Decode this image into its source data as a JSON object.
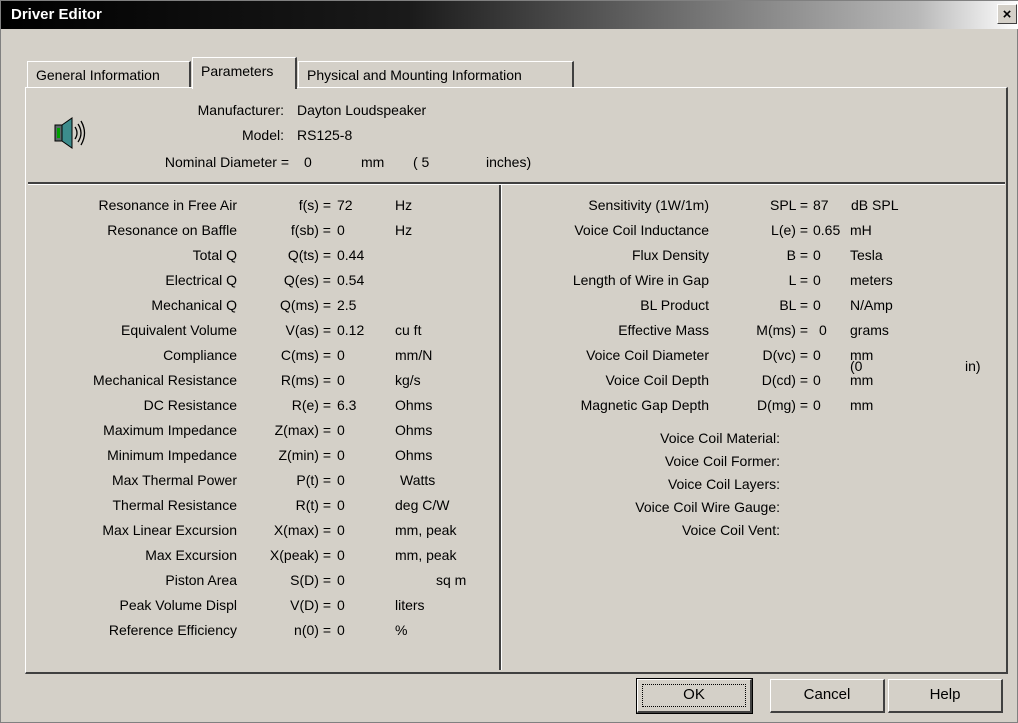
{
  "window": {
    "title": "Driver Editor",
    "close_label": "×"
  },
  "tabs": [
    {
      "label": "General Information"
    },
    {
      "label": "Parameters"
    },
    {
      "label": "Physical and Mounting Information"
    }
  ],
  "header": {
    "manufacturer_label": "Manufacturer:",
    "manufacturer_value": "Dayton Loudspeaker",
    "model_label": "Model:",
    "model_value": "RS125-8",
    "nominal_label": "Nominal Diameter =",
    "nominal_value": "0",
    "nominal_unit": "mm",
    "nominal_paren": "( 5",
    "nominal_inches": "inches)"
  },
  "left_params": [
    {
      "name": "Resonance in Free Air",
      "symbol": "f(s) =",
      "value": "72",
      "unit": "Hz"
    },
    {
      "name": "Resonance on Baffle",
      "symbol": "f(sb) =",
      "value": "0",
      "unit": "Hz"
    },
    {
      "name": "Total Q",
      "symbol": "Q(ts) =",
      "value": "0.44",
      "unit": ""
    },
    {
      "name": "Electrical Q",
      "symbol": "Q(es) =",
      "value": "0.54",
      "unit": ""
    },
    {
      "name": "Mechanical Q",
      "symbol": "Q(ms) =",
      "value": "2.5",
      "unit": ""
    },
    {
      "name": "Equivalent Volume",
      "symbol": "V(as) =",
      "value": "0.12",
      "unit": "cu ft"
    },
    {
      "name": "Compliance",
      "symbol": "C(ms) =",
      "value": "0",
      "unit": "mm/N"
    },
    {
      "name": "Mechanical Resistance",
      "symbol": "R(ms) =",
      "value": "0",
      "unit": "kg/s"
    },
    {
      "name": "DC Resistance",
      "symbol": "R(e) =",
      "value": "6.3",
      "unit": "Ohms"
    },
    {
      "name": "Maximum Impedance",
      "symbol": "Z(max) =",
      "value": "0",
      "unit": "Ohms"
    },
    {
      "name": "Minimum Impedance",
      "symbol": "Z(min) =",
      "value": "0",
      "unit": "Ohms"
    },
    {
      "name": "Max Thermal Power",
      "symbol": "P(t) =",
      "value": "0",
      "unit": "Watts"
    },
    {
      "name": "Thermal Resistance",
      "symbol": "R(t) =",
      "value": "0",
      "unit": "deg C/W"
    },
    {
      "name": "Max Linear Excursion",
      "symbol": "X(max) =",
      "value": "0",
      "unit": "mm, peak"
    },
    {
      "name": "Max Excursion",
      "symbol": "X(peak) =",
      "value": "0",
      "unit": "mm, peak"
    },
    {
      "name": "Piston Area",
      "symbol": "S(D) =",
      "value": "0",
      "unit": "sq m"
    },
    {
      "name": "Peak Volume Displ",
      "symbol": "V(D) =",
      "value": "0",
      "unit": "liters"
    },
    {
      "name": "Reference Efficiency",
      "symbol": "n(0) =",
      "value": "0",
      "unit": "%"
    }
  ],
  "right_params": [
    {
      "name": "Sensitivity (1W/1m)",
      "symbol": "SPL =",
      "value": "87",
      "unit": "dB SPL"
    },
    {
      "name": "Voice Coil Inductance",
      "symbol": "L(e) =",
      "value": "0.65",
      "unit": "mH"
    },
    {
      "name": "Flux Density",
      "symbol": "B =",
      "value": "0",
      "unit": "Tesla"
    },
    {
      "name": "Length of Wire in Gap",
      "symbol": "L =",
      "value": "0",
      "unit": "meters"
    },
    {
      "name": "BL Product",
      "symbol": "BL =",
      "value": "0",
      "unit": "N/Amp"
    },
    {
      "name": "Effective Mass",
      "symbol": "M(ms) =",
      "value": "0",
      "unit": "grams"
    },
    {
      "name": "Voice Coil Diameter",
      "symbol": "D(vc) =",
      "value": "0",
      "unit": "mm"
    },
    {
      "name": "Voice Coil Depth",
      "symbol": "D(cd) =",
      "value": "0",
      "unit": "mm"
    },
    {
      "name": "Magnetic Gap Depth",
      "symbol": "D(mg) =",
      "value": "0",
      "unit": "mm"
    }
  ],
  "vc_diameter_extra": {
    "paren": "(0",
    "unit": "in)"
  },
  "material_labels": [
    {
      "label": "Voice Coil Material:"
    },
    {
      "label": "Voice Coil Former:"
    },
    {
      "label": "Voice Coil Layers:"
    },
    {
      "label": "Voice Coil Wire Gauge:"
    },
    {
      "label": "Voice Coil Vent:"
    }
  ],
  "buttons": {
    "ok": "OK",
    "cancel": "Cancel",
    "help": "Help"
  },
  "icons": {
    "speaker": "speaker-icon",
    "close": "close-icon"
  }
}
